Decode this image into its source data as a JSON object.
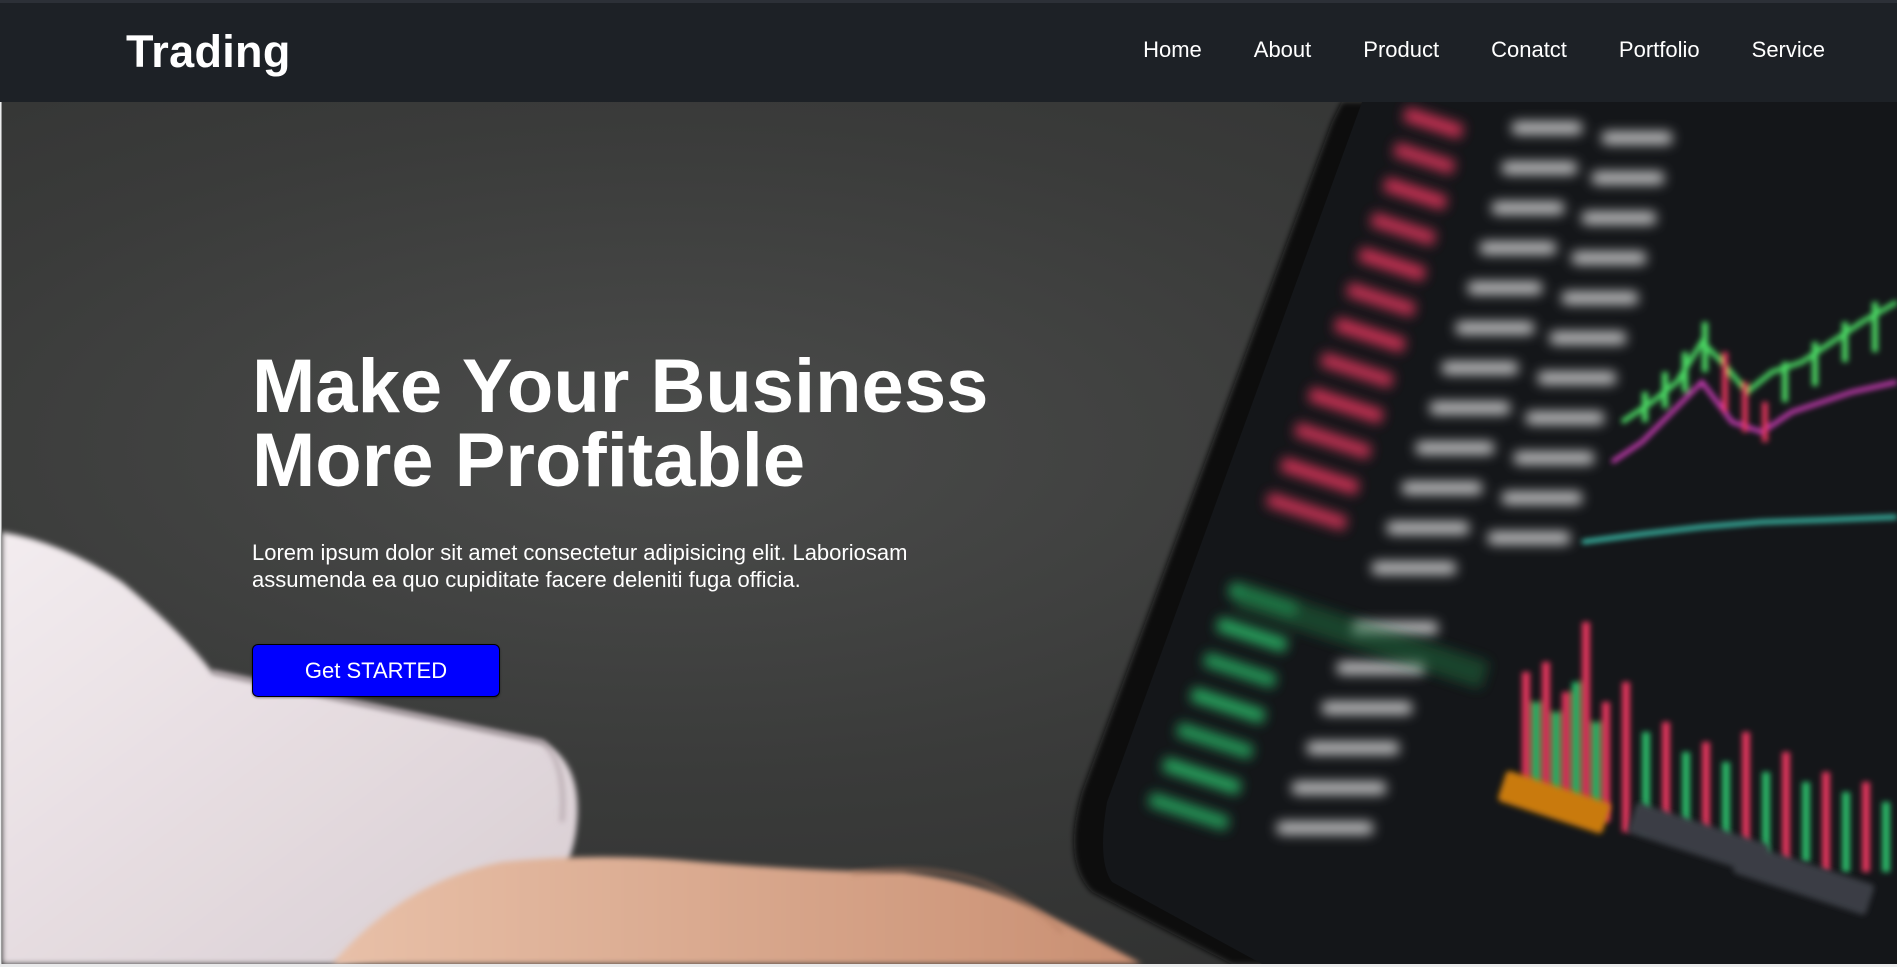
{
  "nav": {
    "brand": "Trading",
    "links": [
      "Home",
      "About",
      "Product",
      "Conatct",
      "Portfolio",
      "Service"
    ]
  },
  "hero": {
    "title_line1": "Make Your Business",
    "title_line2": "More Profitable",
    "text": "Lorem ipsum dolor sit amet consectetur adipisicing elit. Laboriosam assumenda ea quo cupiditate facere deleniti fuga officia.",
    "cta_label": "Get STARTED",
    "background_image": "trading-screen-photo"
  },
  "colors": {
    "navbar_bg": "#1d2126",
    "cta_bg": "#0000ff",
    "text": "#ffffff"
  }
}
